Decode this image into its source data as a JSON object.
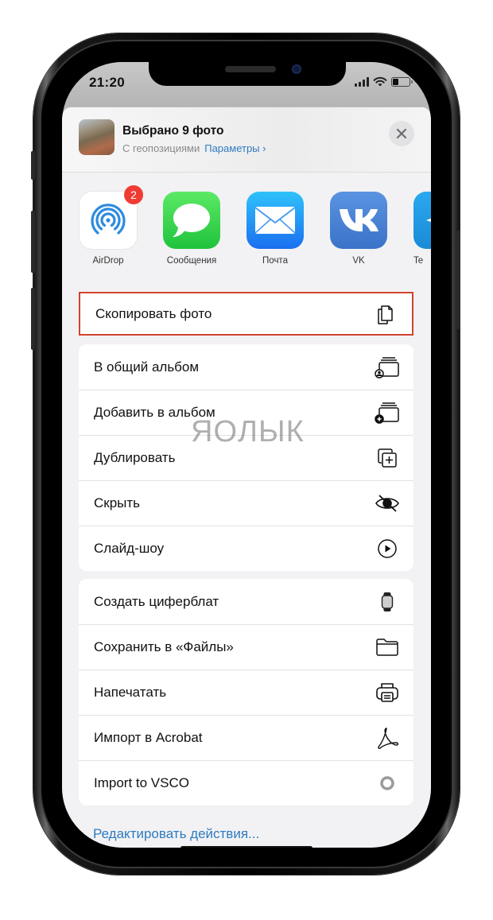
{
  "status_bar": {
    "time": "21:20",
    "signal_bars": 4,
    "battery_level": 0.3
  },
  "share_header": {
    "title": "Выбрано 9 фото",
    "subtitle": "С геопозициями",
    "options_link": "Параметры",
    "chevron": "›",
    "close_icon": "close-icon"
  },
  "apps": [
    {
      "label": "AirDrop",
      "icon": "airdrop-icon",
      "badge": "2"
    },
    {
      "label": "Сообщения",
      "icon": "messages-icon"
    },
    {
      "label": "Почта",
      "icon": "mail-icon"
    },
    {
      "label": "VK",
      "icon": "vk-icon"
    },
    {
      "label": "Te",
      "icon": "telegram-icon"
    }
  ],
  "highlighted_action": {
    "label": "Скопировать фото",
    "icon": "copy-icon",
    "highlight_color": "#d2432f"
  },
  "actions_group_1": [
    {
      "label": "В общий альбом",
      "icon": "shared-album-icon"
    },
    {
      "label": "Добавить в альбом",
      "icon": "add-to-album-icon"
    },
    {
      "label": "Дублировать",
      "icon": "duplicate-icon"
    },
    {
      "label": "Скрыть",
      "icon": "hide-icon"
    },
    {
      "label": "Слайд-шоу",
      "icon": "slideshow-icon"
    }
  ],
  "actions_group_2": [
    {
      "label": "Создать циферблат",
      "icon": "watch-face-icon"
    },
    {
      "label": "Сохранить в «Файлы»",
      "icon": "folder-icon"
    },
    {
      "label": "Напечатать",
      "icon": "print-icon"
    },
    {
      "label": "Импорт в Acrobat",
      "icon": "acrobat-icon"
    },
    {
      "label": "Import to VSCO",
      "icon": "vsco-icon"
    }
  ],
  "edit_actions": "Редактировать действия...",
  "watermark": "ЯOЛЫК",
  "colors": {
    "link": "#2f7bbf",
    "badge": "#ef3b33",
    "highlight": "#d2432f"
  }
}
